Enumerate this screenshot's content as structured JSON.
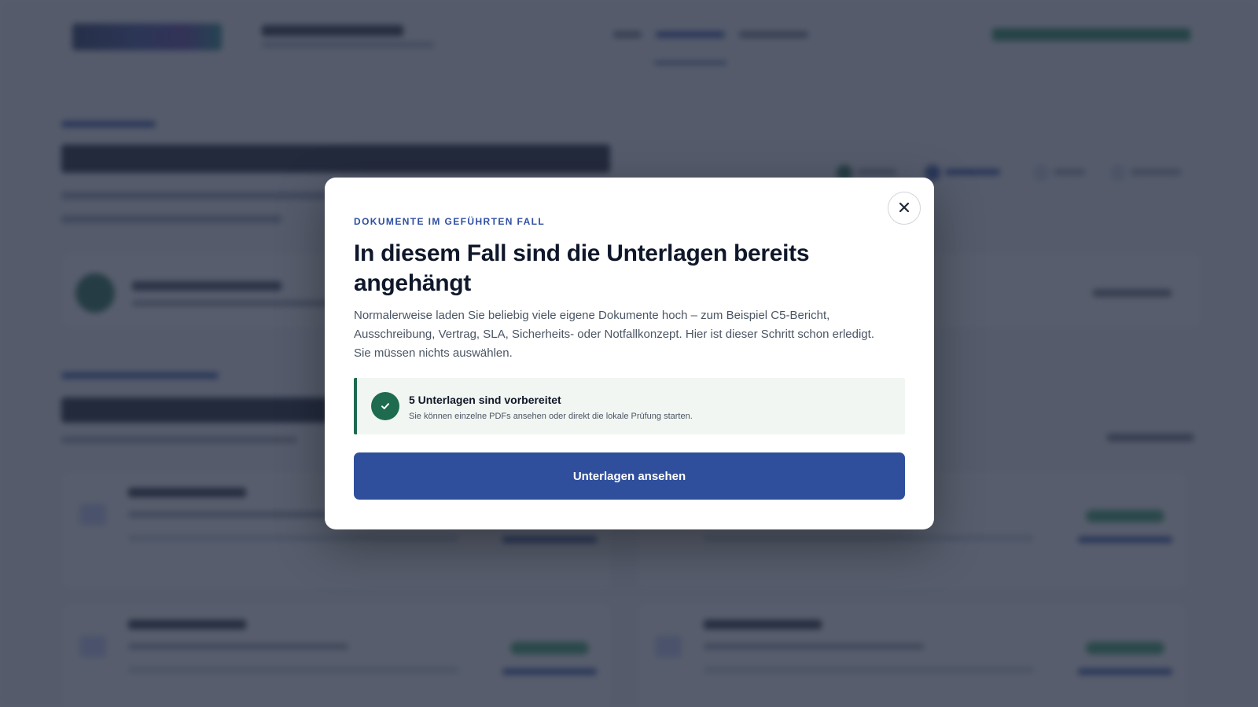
{
  "modal": {
    "eyebrow": "DOKUMENTE IM GEFÜHRTEN FALL",
    "title": "In diesem Fall sind die Unterlagen bereits angehängt",
    "description": "Normalerweise laden Sie beliebig viele eigene Dokumente hoch – zum Beispiel C5-Bericht, Ausschreibung, Vertrag, SLA, Sicherheits- oder Notfallkonzept. Hier ist dieser Schritt schon erledigt. Sie müssen nichts auswählen.",
    "close_icon": "close-icon",
    "notice": {
      "icon": "check-icon",
      "title": "5 Unterlagen sind vorbereitet",
      "subtitle": "Sie können einzelne PDFs ansehen oder direkt die lokale Prüfung starten."
    },
    "primary_button": "Unterlagen ansehen"
  },
  "colors": {
    "accent": "#2f4f9c",
    "success": "#1f6b4f",
    "overlay": "#283042"
  }
}
